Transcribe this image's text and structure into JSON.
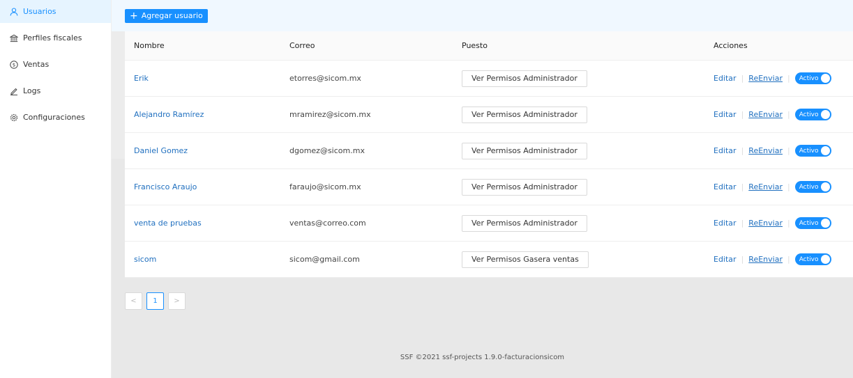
{
  "sidebar": {
    "items": [
      {
        "label": "Usuarios",
        "icon": "user-icon",
        "active": true
      },
      {
        "label": "Perfiles fiscales",
        "icon": "bank-icon"
      },
      {
        "label": "Ventas",
        "icon": "dollar-icon"
      },
      {
        "label": "Logs",
        "icon": "pen-icon"
      },
      {
        "label": "Configuraciones",
        "icon": "gear-icon"
      }
    ]
  },
  "toolbar": {
    "add_label": "Agregar usuario"
  },
  "table": {
    "columns": [
      "Nombre",
      "Correo",
      "Puesto",
      "Acciones"
    ],
    "rows": [
      {
        "name": "Erik",
        "email": "etorres@sicom.mx",
        "position": "Ver Permisos Administrador",
        "edit": "Editar",
        "resend": "ReEnviar",
        "status": "Activo"
      },
      {
        "name": "Alejandro Ramírez",
        "email": "mramirez@sicom.mx",
        "position": "Ver Permisos Administrador",
        "edit": "Editar",
        "resend": "ReEnviar",
        "status": "Activo"
      },
      {
        "name": "Daniel Gomez",
        "email": "dgomez@sicom.mx",
        "position": "Ver Permisos Administrador",
        "edit": "Editar",
        "resend": "ReEnviar",
        "status": "Activo"
      },
      {
        "name": "Francisco Araujo",
        "email": "faraujo@sicom.mx",
        "position": "Ver Permisos Administrador",
        "edit": "Editar",
        "resend": "ReEnviar",
        "status": "Activo"
      },
      {
        "name": "venta de pruebas",
        "email": "ventas@correo.com",
        "position": "Ver Permisos Administrador",
        "edit": "Editar",
        "resend": "ReEnviar",
        "status": "Activo"
      },
      {
        "name": "sicom",
        "email": "sicom@gmail.com",
        "position": "Ver Permisos Gasera ventas",
        "edit": "Editar",
        "resend": "ReEnviar",
        "status": "Activo"
      }
    ]
  },
  "pagination": {
    "prev": "<",
    "current": "1",
    "next": ">"
  },
  "footer": {
    "text": "SSF ©2021 ssf-projects 1.9.0-facturacionsicom"
  },
  "colors": {
    "accent": "#1890ff",
    "link": "#1f6fbf",
    "topbar": "#f0f8ff",
    "active_bg": "#e6f4ff"
  }
}
